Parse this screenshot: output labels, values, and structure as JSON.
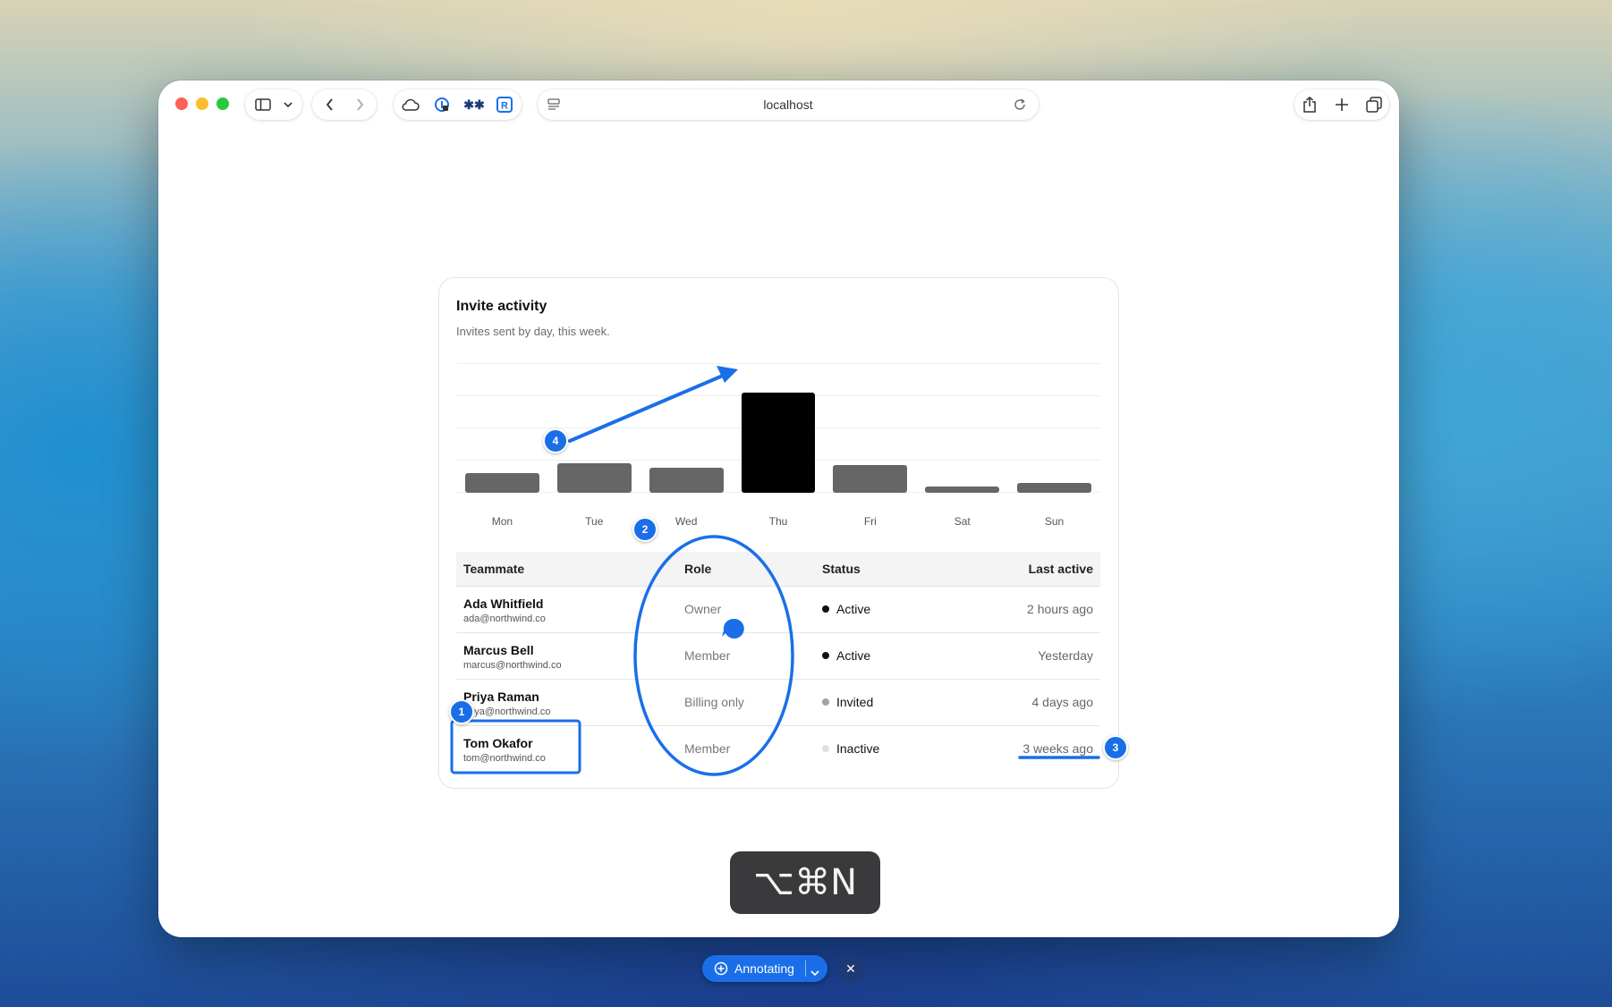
{
  "browser": {
    "url": "localhost",
    "colors": {
      "close": "#ff5f57",
      "minimize": "#febc2e",
      "zoom": "#28c840"
    }
  },
  "card": {
    "title": "Invite activity",
    "subtitle": "Invites sent by day, this week."
  },
  "chart_data": {
    "type": "bar",
    "categories": [
      "Mon",
      "Tue",
      "Wed",
      "Thu",
      "Fri",
      "Sat",
      "Sun"
    ],
    "values": [
      2,
      3,
      2.5,
      10,
      2.8,
      0.6,
      1
    ],
    "ylim": [
      0,
      13
    ],
    "grid": true,
    "highlight_color": "#000000",
    "bar_color": "#666666",
    "xlabel": "",
    "ylabel": ""
  },
  "table": {
    "headers": {
      "teammate": "Teammate",
      "role": "Role",
      "status": "Status",
      "last_active": "Last active"
    },
    "rows": [
      {
        "name": "Ada Whitfield",
        "email": "ada@northwind.co",
        "role": "Owner",
        "status": "Active",
        "status_color": "#111111",
        "last_active": "2 hours ago"
      },
      {
        "name": "Marcus Bell",
        "email": "marcus@northwind.co",
        "role": "Member",
        "status": "Active",
        "status_color": "#111111",
        "last_active": "Yesterday"
      },
      {
        "name": "Priya Raman",
        "email": "priya@northwind.co",
        "role": "Billing only",
        "status": "Invited",
        "status_color": "#a3a3a3",
        "last_active": "4 days ago"
      },
      {
        "name": "Tom Okafor",
        "email": "tom@northwind.co",
        "role": "Member",
        "status": "Inactive",
        "status_color": "#e0e0e0",
        "last_active": "3 weeks ago"
      }
    ]
  },
  "annotations": {
    "color": "#1a6fe8",
    "badges": [
      "1",
      "2",
      "3",
      "4"
    ]
  },
  "shortcut": {
    "keys": "⌥⌘N"
  },
  "annotating": {
    "label": "Annotating"
  }
}
